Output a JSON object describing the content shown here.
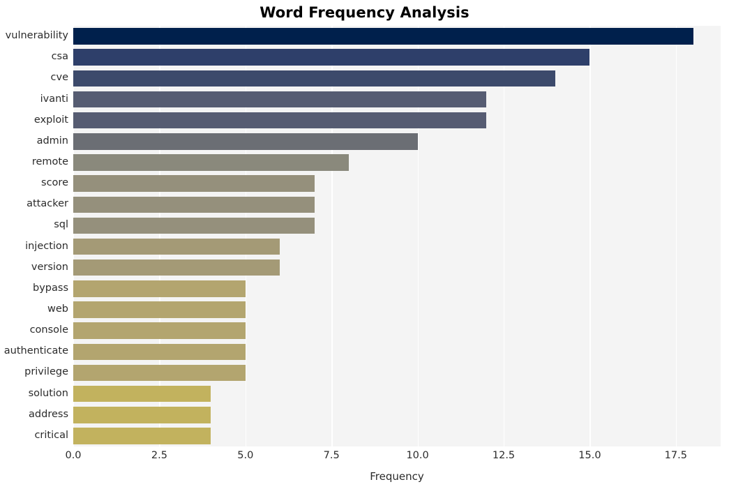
{
  "chart_data": {
    "type": "bar",
    "orientation": "horizontal",
    "title": "Word Frequency Analysis",
    "xlabel": "Frequency",
    "ylabel": "",
    "categories": [
      "vulnerability",
      "csa",
      "cve",
      "ivanti",
      "exploit",
      "admin",
      "remote",
      "score",
      "attacker",
      "sql",
      "injection",
      "version",
      "bypass",
      "web",
      "console",
      "authenticate",
      "privilege",
      "solution",
      "address",
      "critical"
    ],
    "values": [
      18,
      15,
      14,
      12,
      12,
      10,
      8,
      7,
      7,
      7,
      6,
      6,
      5,
      5,
      5,
      5,
      5,
      4,
      4,
      4
    ],
    "bar_colors": [
      "#00204c",
      "#2e3f6a",
      "#3c4a6b",
      "#565c72",
      "#565c72",
      "#6b6e74",
      "#8a897c",
      "#95907c",
      "#95907c",
      "#95907c",
      "#a49a76",
      "#a49a76",
      "#b3a56f",
      "#b3a56f",
      "#b3a56f",
      "#b3a56f",
      "#b3a56f",
      "#c2b25e",
      "#c2b25e",
      "#c2b25e"
    ],
    "colormap": "cividis",
    "xlim": [
      0.0,
      18.8
    ],
    "x_ticks": [
      "0.0",
      "2.5",
      "5.0",
      "7.5",
      "10.0",
      "12.5",
      "15.0",
      "17.5"
    ],
    "x_tick_values": [
      0.0,
      2.5,
      5.0,
      7.5,
      10.0,
      12.5,
      15.0,
      17.5
    ],
    "grid": "vertical-only",
    "grid_color": "#ffffff",
    "plot_background": "#f4f4f4",
    "figure_background": "#ffffff",
    "legend": null,
    "style": "seaborn-whitegrid"
  }
}
